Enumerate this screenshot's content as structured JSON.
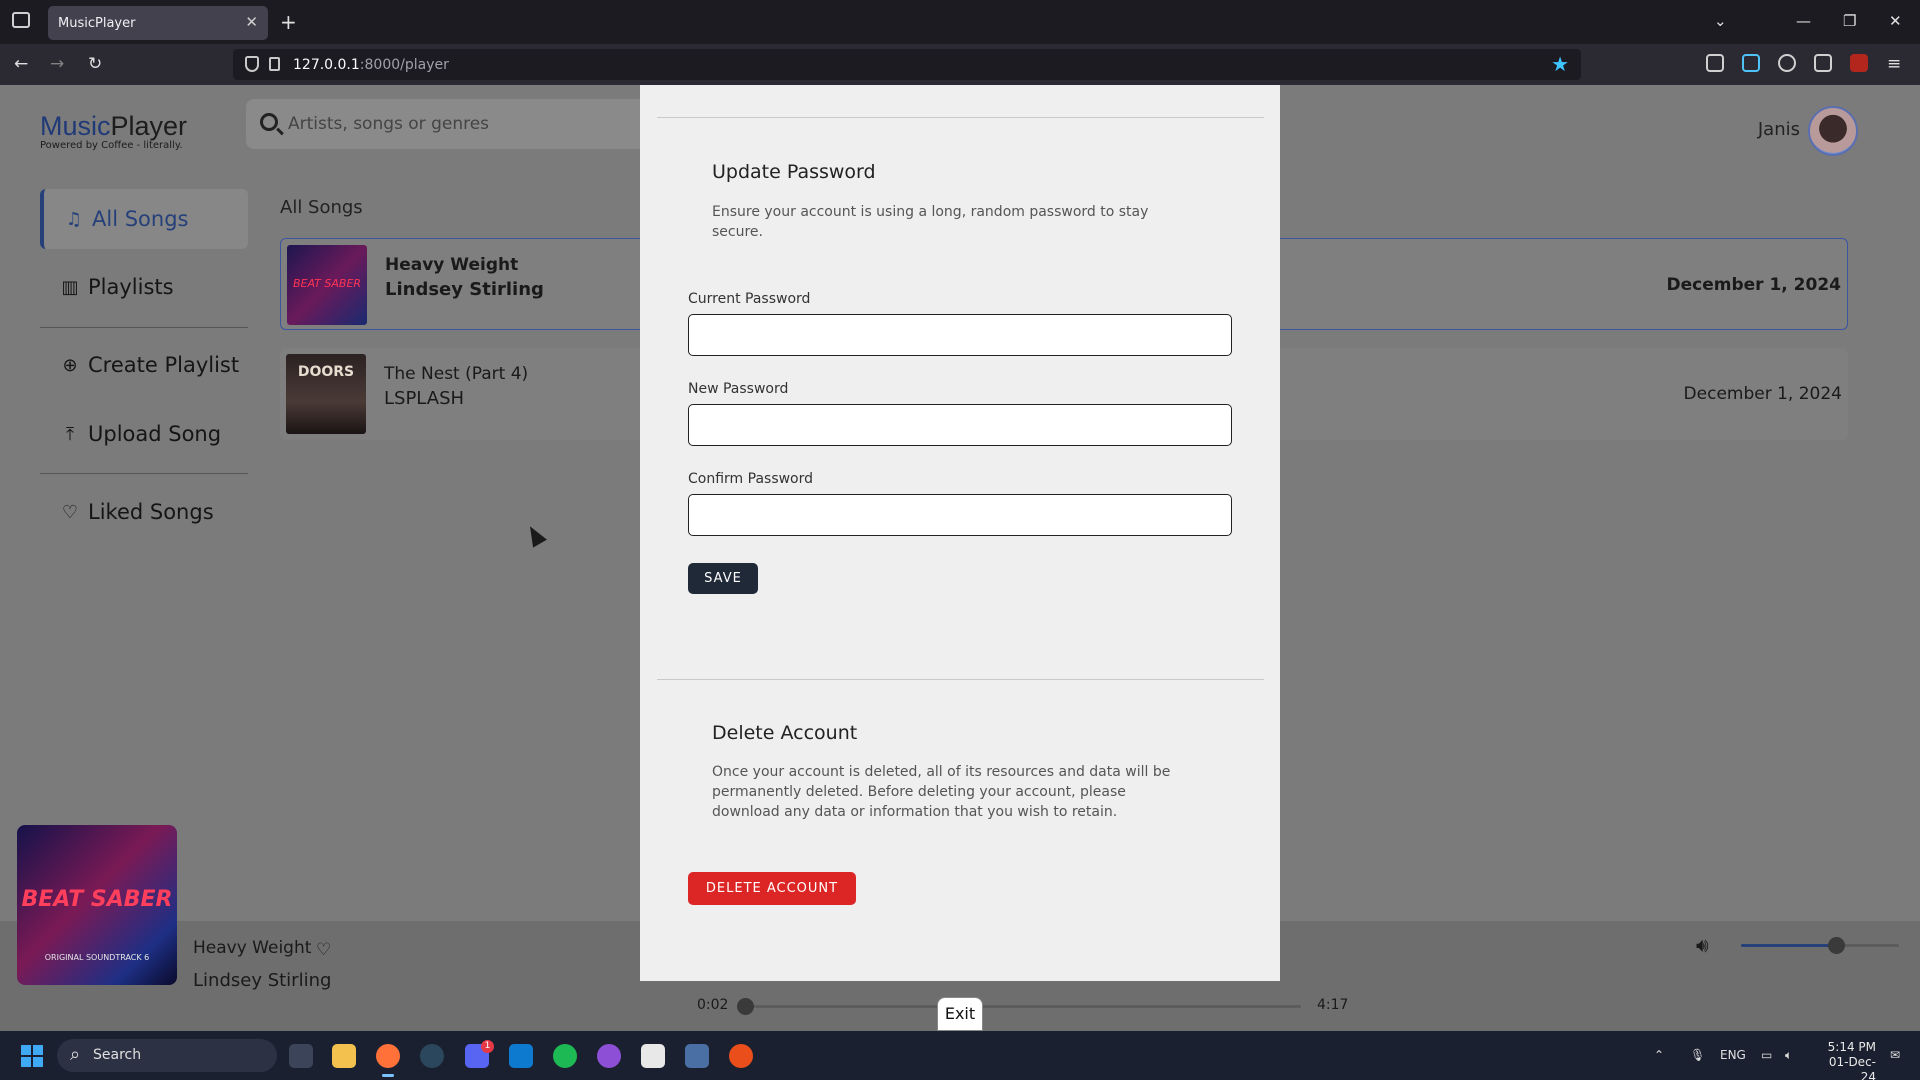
{
  "browser": {
    "tab_title": "MusicPlayer",
    "tab_close": "✕",
    "new_tab": "+",
    "url_host": "127.0.0.1",
    "url_rest": ":8000/player",
    "window_controls": [
      "⌄",
      "—",
      "❐",
      "✕"
    ]
  },
  "app": {
    "logo_music": "Music",
    "logo_player": "Player",
    "logo_sub": "Powered by Coffee - literally.",
    "search_placeholder": "Artists, songs or genres",
    "user_name": "Janis"
  },
  "sidebar": {
    "items": [
      {
        "label": "All Songs",
        "icon": "♫"
      },
      {
        "label": "Playlists",
        "icon": "▥"
      },
      {
        "label": "Create Playlist",
        "icon": "⊕"
      },
      {
        "label": "Upload Song",
        "icon": "⤒"
      },
      {
        "label": "Liked Songs",
        "icon": "♡"
      }
    ]
  },
  "main": {
    "section_title": "All Songs",
    "songs": [
      {
        "title": "Heavy Weight",
        "artist": "Lindsey Stirling",
        "date": "December 1, 2024"
      },
      {
        "title": "The Nest (Part 4)",
        "artist": "LSPLASH",
        "date": "December 1, 2024"
      }
    ]
  },
  "modal": {
    "update_title": "Update Password",
    "update_desc": "Ensure your account is using a long, random password to stay secure.",
    "current_password_label": "Current Password",
    "new_password_label": "New Password",
    "confirm_password_label": "Confirm Password",
    "save_label": "SAVE",
    "delete_title": "Delete Account",
    "delete_desc": "Once your account is deleted, all of its resources and data will be permanently deleted. Before deleting your account, please download any data or information that you wish to retain.",
    "delete_label": "DELETE ACCOUNT"
  },
  "player": {
    "title": "Heavy Weight",
    "artist": "Lindsey Stirling",
    "art_text": "BEAT SABER",
    "art_subtext": "ORIGINAL SOUNDTRACK 6",
    "time_current": "0:02",
    "time_total": "4:17",
    "progress_fraction": 0.008,
    "volume_fraction": 0.6,
    "exit_label": "Exit"
  },
  "taskbar": {
    "search_label": "Search",
    "lang": "ENG",
    "time": "5:14 PM",
    "date": "01-Dec-24",
    "discord_badge": "1"
  },
  "colors": {
    "accent": "#26407a",
    "danger": "#dc2626",
    "dark_button": "#1f2937",
    "star": "#3ec6ff"
  }
}
